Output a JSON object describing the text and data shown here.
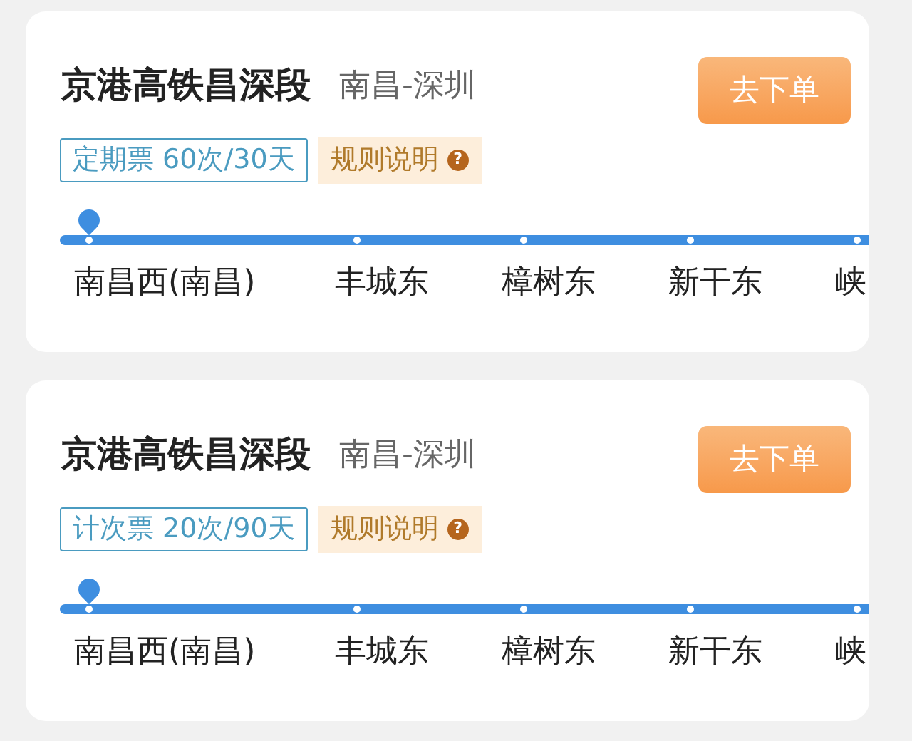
{
  "cards": [
    {
      "title": "京港高铁昌深段",
      "route": "南昌-深圳",
      "button": "去下单",
      "ticket_tag": "定期票 60次/30天",
      "rules": "规则说明",
      "rules_icon": "?",
      "stations": [
        {
          "name": "南昌西(南昌)",
          "selected": true
        },
        {
          "name": "丰城东",
          "selected": false
        },
        {
          "name": "樟树东",
          "selected": false
        },
        {
          "name": "新干东",
          "selected": false
        },
        {
          "name": "峡",
          "selected": false
        }
      ]
    },
    {
      "title": "京港高铁昌深段",
      "route": "南昌-深圳",
      "button": "去下单",
      "ticket_tag": "计次票 20次/90天",
      "rules": "规则说明",
      "rules_icon": "?",
      "stations": [
        {
          "name": "南昌西(南昌)",
          "selected": true
        },
        {
          "name": "丰城东",
          "selected": false
        },
        {
          "name": "樟树东",
          "selected": false
        },
        {
          "name": "新干东",
          "selected": false
        },
        {
          "name": "峡",
          "selected": false
        }
      ]
    }
  ]
}
